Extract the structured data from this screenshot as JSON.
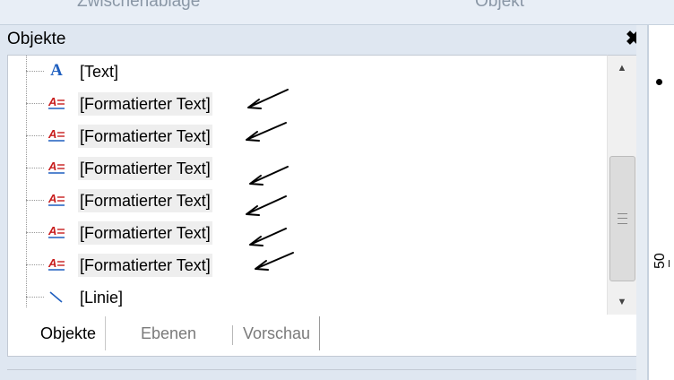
{
  "ribbon": {
    "group_left": "Zwischenablage",
    "group_right": "Objekt"
  },
  "panel": {
    "title": "Objekte",
    "close_label": "✖"
  },
  "tree": {
    "items": [
      {
        "label": "[Text]",
        "icon": "text-icon",
        "selected": false
      },
      {
        "label": "[Formatierter Text]",
        "icon": "formatted-text-icon",
        "selected": true
      },
      {
        "label": "[Formatierter Text]",
        "icon": "formatted-text-icon",
        "selected": true
      },
      {
        "label": "[Formatierter Text]",
        "icon": "formatted-text-icon",
        "selected": true
      },
      {
        "label": "[Formatierter Text]",
        "icon": "formatted-text-icon",
        "selected": true
      },
      {
        "label": "[Formatierter Text]",
        "icon": "formatted-text-icon",
        "selected": true
      },
      {
        "label": "[Formatierter Text]",
        "icon": "formatted-text-icon",
        "selected": true
      },
      {
        "label": "[Linie]",
        "icon": "line-icon",
        "selected": false
      }
    ]
  },
  "tabs": [
    {
      "label": "Objekte",
      "active": true
    },
    {
      "label": "Ebenen",
      "active": false
    },
    {
      "label": "Vorschau",
      "active": false
    }
  ],
  "ruler": {
    "mark_label": "50"
  },
  "colors": {
    "accent_blue": "#1f5fbf",
    "icon_red": "#c81e1e",
    "selection_bg": "#eeeeee"
  }
}
